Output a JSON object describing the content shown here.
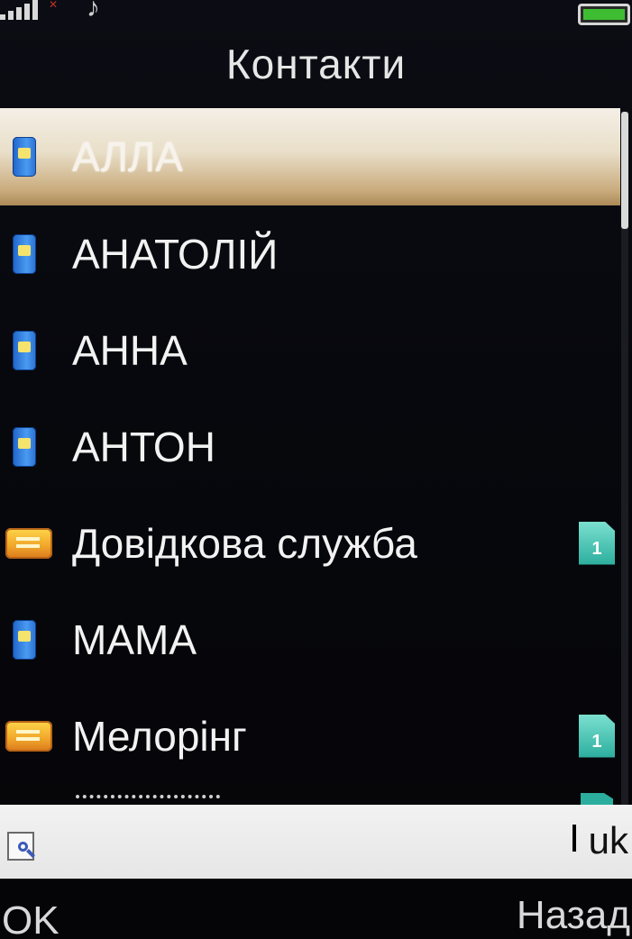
{
  "status_bar": {
    "signal_icon": "signal-bars-icon",
    "network_icon": "no-network-x-icon",
    "music_icon": "music-note-icon",
    "battery_icon": "battery-full-icon",
    "battery_color": "#3ebd32"
  },
  "header": {
    "title": "Контакти"
  },
  "contacts": [
    {
      "name": "АЛЛА",
      "icon": "phone-icon",
      "selected": true,
      "sim_badge": ""
    },
    {
      "name": "АНАТОЛІЙ",
      "icon": "phone-icon",
      "selected": false,
      "sim_badge": ""
    },
    {
      "name": "АННА",
      "icon": "phone-icon",
      "selected": false,
      "sim_badge": ""
    },
    {
      "name": "АНТОН",
      "icon": "phone-icon",
      "selected": false,
      "sim_badge": ""
    },
    {
      "name": "Довідкова служба",
      "icon": "sim-card-contact-icon",
      "selected": false,
      "sim_badge": "1"
    },
    {
      "name": "МАМА",
      "icon": "phone-icon",
      "selected": false,
      "sim_badge": ""
    },
    {
      "name": "Мелорінг",
      "icon": "sim-card-contact-icon",
      "selected": false,
      "sim_badge": "1"
    }
  ],
  "search": {
    "value": "",
    "input_lang": "uk",
    "icon": "search-icon"
  },
  "softkeys": {
    "left": "OK",
    "right": "Назад"
  },
  "colors": {
    "background": "#050508",
    "selected_top": "#f4efe6",
    "selected_bottom": "#ab8a57",
    "sim_badge": "#2cae9e"
  }
}
